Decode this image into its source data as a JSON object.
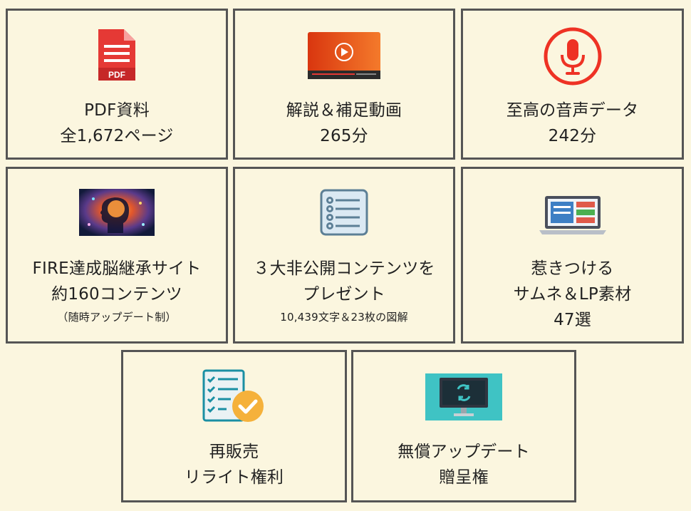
{
  "cards": [
    {
      "icon": "pdf-document-icon",
      "lines": [
        "PDF資料",
        "全1,672ページ"
      ]
    },
    {
      "icon": "video-player-icon",
      "lines": [
        "解説＆補足動画",
        "265分"
      ]
    },
    {
      "icon": "microphone-icon",
      "lines": [
        "至高の音声データ",
        "242分"
      ]
    },
    {
      "icon": "brain-head-image-icon",
      "lines": [
        "FIRE達成脳継承サイト",
        "約160コンテンツ"
      ],
      "note": "（随時アップデート制）"
    },
    {
      "icon": "checklist-document-icon",
      "lines": [
        "３大非公開コンテンツを",
        "プレゼント"
      ],
      "note": "10,439文字＆23枚の図解"
    },
    {
      "icon": "laptop-thumbnail-icon",
      "lines": [
        "惹きつける",
        "サムネ＆LP素材",
        "47選"
      ]
    },
    {
      "icon": "checklist-approved-icon",
      "lines": [
        "再販売",
        "リライト権利"
      ]
    },
    {
      "icon": "monitor-update-icon",
      "lines": [
        "無償アップデート",
        "贈呈権"
      ]
    }
  ],
  "colors": {
    "background": "#fbf6df",
    "border": "#555555",
    "pdf_red": "#e53935",
    "video_orange": "#ef5a24",
    "mic_red": "#ee3224",
    "checklist_blue": "#5c7f96",
    "laptop_blue": "#3d7fc4",
    "approved_teal": "#1a8fa3",
    "approved_orange": "#f5b13b",
    "monitor_cyan": "#3fc3c4"
  }
}
